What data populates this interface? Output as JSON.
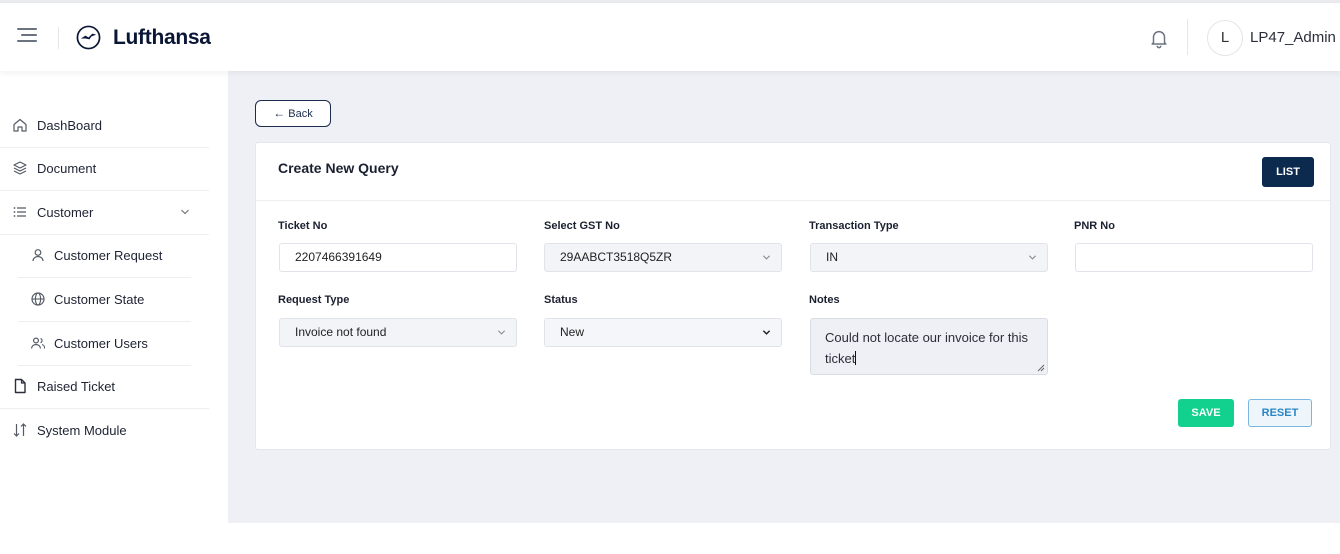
{
  "header": {
    "brand": "Lufthansa",
    "avatar_initial": "L",
    "username": "LP47_Admin"
  },
  "sidebar": {
    "items": [
      {
        "label": "DashBoard",
        "icon": "home-icon"
      },
      {
        "label": "Document",
        "icon": "layers-icon"
      },
      {
        "label": "Customer",
        "icon": "list-icon",
        "expanded": true
      },
      {
        "label": "Customer Request",
        "icon": "user-icon"
      },
      {
        "label": "Customer State",
        "icon": "globe-icon"
      },
      {
        "label": "Customer Users",
        "icon": "users-icon"
      },
      {
        "label": "Raised Ticket",
        "icon": "file-icon"
      },
      {
        "label": "System Module",
        "icon": "sort-arrows-icon"
      }
    ]
  },
  "page": {
    "back_label": "Back",
    "card_title": "Create New Query",
    "list_label": "LIST",
    "save_label": "SAVE",
    "reset_label": "RESET"
  },
  "form": {
    "ticket_no": {
      "label": "Ticket No",
      "value": "2207466391649"
    },
    "gst_no": {
      "label": "Select GST No",
      "value": "29AABCT3518Q5ZR"
    },
    "transaction_type": {
      "label": "Transaction Type",
      "value": "IN"
    },
    "pnr_no": {
      "label": "PNR No",
      "value": ""
    },
    "request_type": {
      "label": "Request Type",
      "value": "Invoice not found"
    },
    "status": {
      "label": "Status",
      "value": "New"
    },
    "notes": {
      "label": "Notes",
      "value": "Could not locate our invoice for this ticket"
    }
  },
  "colors": {
    "brand_navy": "#0b2a4e",
    "save_green": "#12d18e",
    "reset_blue": "#2a86c4",
    "main_bg": "#eef0f6"
  }
}
